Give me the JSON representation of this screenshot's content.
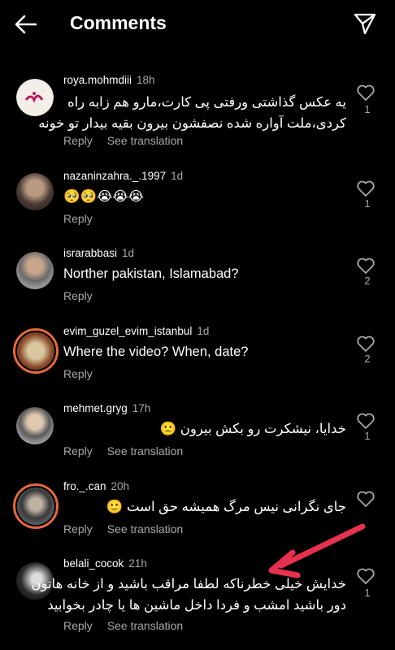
{
  "header": {
    "title": "Comments",
    "back_icon": "back-arrow-icon",
    "send_icon": "send-icon"
  },
  "labels": {
    "reply": "Reply",
    "see_translation": "See translation"
  },
  "comments": [
    {
      "username": "roya.mohmdiii",
      "time": "18h",
      "lines": [
        "یه عکس گذاشتی ورفتی پی کارت،مارو هم زابه راه",
        "کردی،ملت آواره شده نصفشون بیرون بقیه بیدار تو خونه"
      ],
      "likes": "1",
      "translation": true
    },
    {
      "username": "nazaninzahra._.1997",
      "time": "1d",
      "lines": [
        "🥺🥺😭😭😭"
      ],
      "likes": "1",
      "translation": false
    },
    {
      "username": "israrabbasi",
      "time": "1d",
      "lines": [
        "Norther pakistan, Islamabad?"
      ],
      "likes": "2",
      "translation": false
    },
    {
      "username": "evim_guzel_evim_istanbul",
      "time": "1d",
      "lines": [
        "Where the video? When, date?"
      ],
      "likes": "2",
      "translation": false
    },
    {
      "username": "mehmet.gryg",
      "time": "17h",
      "lines": [
        "خدایا، نیشکرت رو بکش بیرون 🙁"
      ],
      "likes": "1",
      "translation": true
    },
    {
      "username": "fro._.can",
      "time": "20h",
      "lines": [
        "جای نگرانی نیس مرگ همیشه حق است 🙂"
      ],
      "likes": "",
      "translation": true
    },
    {
      "username": "belali_cocok",
      "time": "21h",
      "lines": [
        "خدایش خیلی خطرناکه لطفا مراقب باشید و از خانه هاتون",
        "دور باشید امشب و فردا داخل ماشین ها یا چادر بخوابید"
      ],
      "likes": "1",
      "translation": true
    }
  ],
  "colors": {
    "background": "#000000",
    "secondary_text": "#a8a8a8",
    "annotation_arrow": "#e8314f"
  }
}
